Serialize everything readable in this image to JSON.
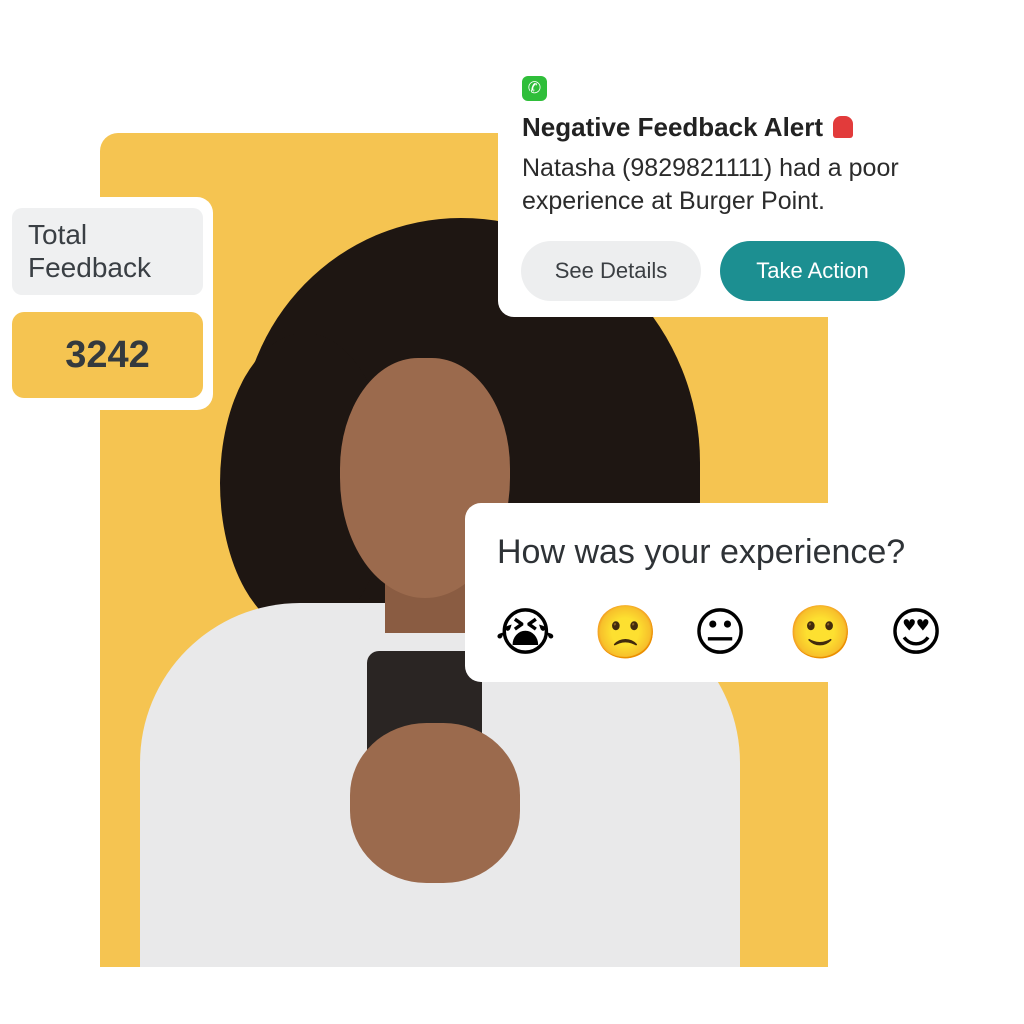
{
  "total_feedback": {
    "label": "Total Feedback",
    "value": "3242"
  },
  "alert": {
    "app_icon": "whatsapp-icon",
    "title": "Negative Feedback Alert",
    "title_icon": "siren-icon",
    "message": "Natasha (9829821111) had a poor experience at Burger Point.",
    "see_details": "See Details",
    "take_action": "Take Action"
  },
  "survey": {
    "question": "How was your experience?",
    "options": [
      {
        "icon": "crying-face-icon",
        "glyph": "😭"
      },
      {
        "icon": "frowning-face-icon",
        "glyph": "🙁"
      },
      {
        "icon": "neutral-face-icon",
        "glyph": "😐"
      },
      {
        "icon": "slightly-smiling-face-icon",
        "glyph": "🙂"
      },
      {
        "icon": "heart-eyes-face-icon",
        "glyph": "😍"
      }
    ]
  },
  "colors": {
    "yellow": "#F5C451",
    "teal": "#1C8F91",
    "whatsapp": "#2FBE3A"
  }
}
